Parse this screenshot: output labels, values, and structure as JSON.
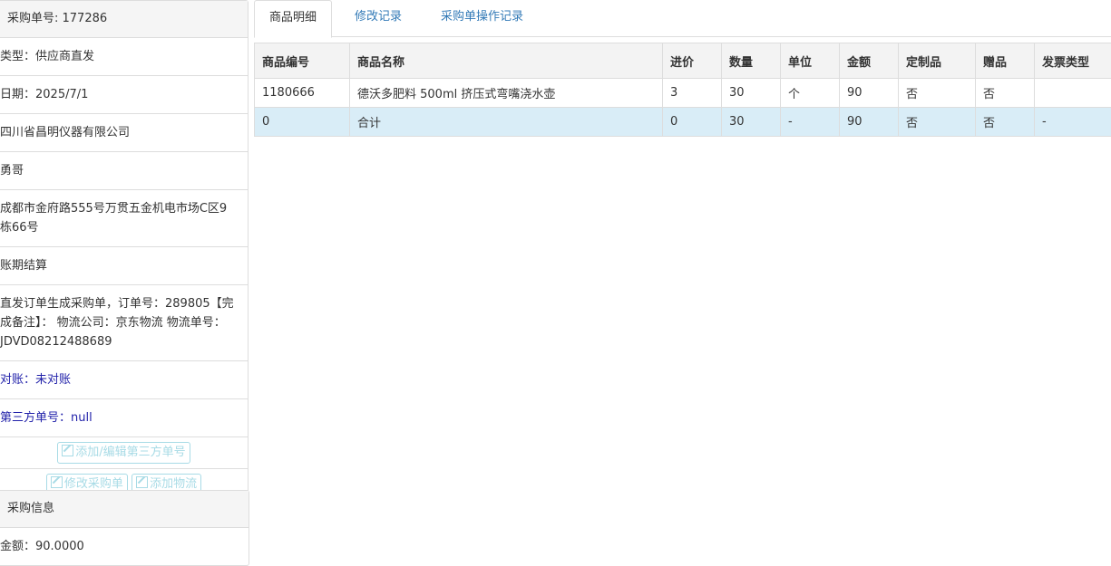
{
  "order_panel": {
    "heading": "采购单号: 177286",
    "rows": [
      "类型：供应商直发",
      "日期：2025/7/1",
      "四川省昌明仪器有限公司",
      "勇哥",
      "成都市金府路555号万贯五金机电市场C区9栋66号",
      "账期结算",
      "直发订单生成采购单，订单号：289805【完成备注】： 物流公司：京东物流 物流单号：JDVD08212488689",
      "对账：未对账",
      "第三方单号：null"
    ],
    "buttons": {
      "edit_third_party": "添加/编辑第三方单号",
      "modify_order": "修改采购单",
      "add_logistics": "添加物流"
    }
  },
  "purchase_panel": {
    "heading": "采购信息",
    "amount": "金额：90.0000"
  },
  "tabs": [
    "商品明细",
    "修改记录",
    "采购单操作记录"
  ],
  "table": {
    "headers": [
      "商品编号",
      "商品名称",
      "进价",
      "数量",
      "单位",
      "金额",
      "定制品",
      "赠品",
      "发票类型"
    ],
    "rows": [
      [
        "1180666",
        "德沃多肥料 500ml 挤压式弯嘴浇水壶",
        "3",
        "30",
        "个",
        "90",
        "否",
        "否",
        ""
      ],
      [
        "0",
        "合计",
        "0",
        "30",
        "-",
        "90",
        "否",
        "否",
        "-"
      ]
    ]
  },
  "colors": {
    "link": "#2222aa",
    "tab_link": "#337ab7",
    "total_row": "#d9edf7",
    "button": "#a8dbe6"
  }
}
